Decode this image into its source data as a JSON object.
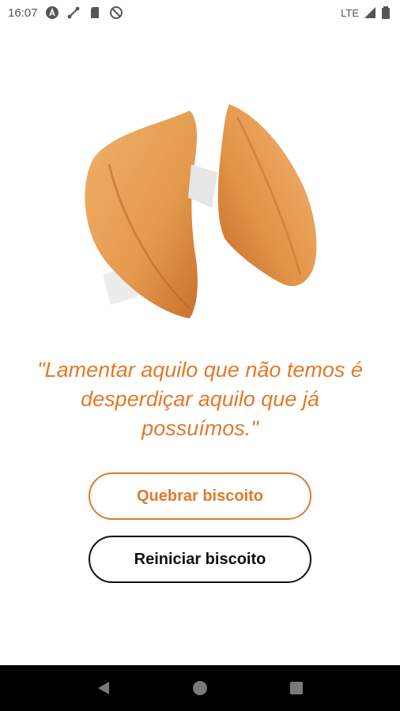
{
  "status_bar": {
    "time": "16:07",
    "network": "LTE",
    "icons": [
      "a-circle-icon",
      "route-icon",
      "sd-card-icon",
      "no-disturb-icon",
      "signal-icon",
      "battery-icon"
    ]
  },
  "cookie_image": {
    "icon": "fortune-cookie-broken-image",
    "colors": {
      "cookie": "#e49a4e",
      "cookie_dark": "#c9712c",
      "paper": "#ececec"
    }
  },
  "quote": {
    "text": "\"Lamentar aquilo que não temos é desperdiçar aquilo que já possuímos.\""
  },
  "buttons": {
    "break_label": "Quebrar biscoito",
    "reset_label": "Reiniciar biscoito"
  },
  "nav_bar": {
    "icons": [
      "back-icon",
      "home-icon",
      "recents-icon"
    ]
  },
  "colors": {
    "accent": "#e2792a",
    "text_dark": "#111111",
    "background": "#ffffff",
    "nav_bar": "#000000"
  }
}
